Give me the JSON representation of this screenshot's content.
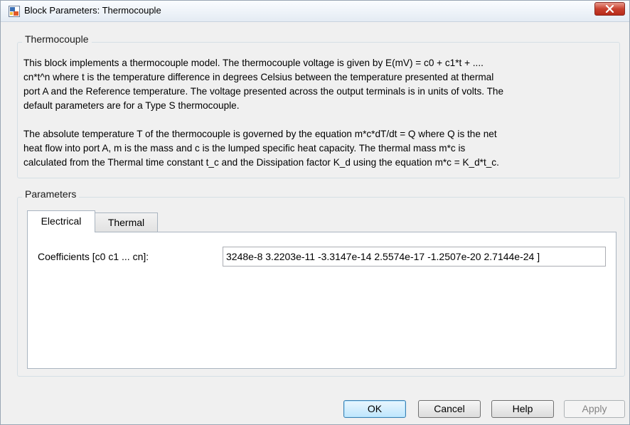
{
  "window": {
    "title": "Block Parameters: Thermocouple"
  },
  "description_group": {
    "label": "Thermocouple",
    "paragraph1": [
      "This block implements a thermocouple model. The thermocouple voltage is given by E(mV) = c0 + c1*t + ....",
      "cn*t^n where t is the temperature difference in degrees Celsius between the temperature presented at thermal",
      "port A and the Reference temperature. The voltage presented across the output terminals is in units of volts. The",
      "default parameters are for a Type S thermocouple."
    ],
    "paragraph2": [
      "The absolute temperature T of the thermocouple is governed by the equation m*c*dT/dt = Q where Q is the net",
      "heat flow into port A, m is the mass and c is the lumped specific heat capacity. The thermal mass m*c is",
      "calculated from the Thermal time constant t_c and the Dissipation factor K_d using the equation m*c = K_d*t_c."
    ]
  },
  "parameters_group": {
    "label": "Parameters",
    "tabs": [
      {
        "label": "Electrical",
        "active": true
      },
      {
        "label": "Thermal",
        "active": false
      }
    ],
    "coefficients": {
      "label": "Coefficients [c0 c1 ... cn]:",
      "value": "3248e-8 3.2203e-11 -3.3147e-14 2.5574e-17 -1.2507e-20 2.7144e-24 ]"
    }
  },
  "buttons": {
    "ok": "OK",
    "cancel": "Cancel",
    "help": "Help",
    "apply": "Apply"
  },
  "colors": {
    "close_button": "#c8412f",
    "default_button_border": "#3c7fb1"
  },
  "icons": {
    "app": "simulink-block-icon",
    "close": "close-x-icon"
  }
}
